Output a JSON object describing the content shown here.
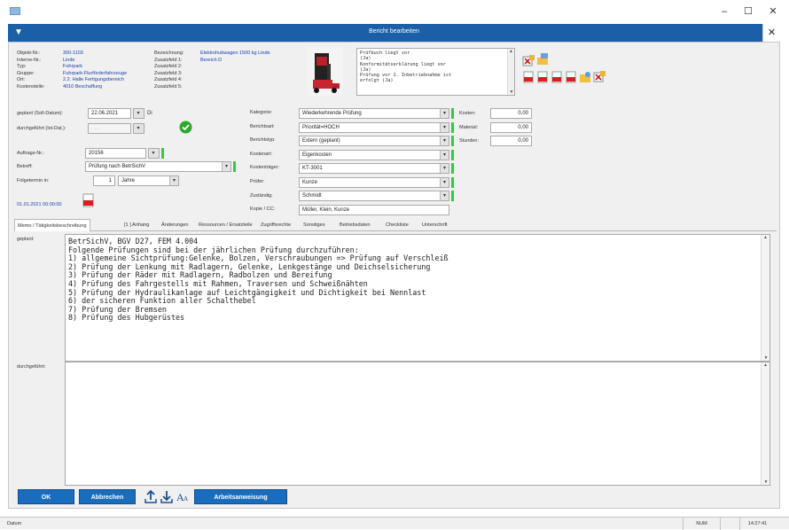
{
  "window": {
    "minimize": "–",
    "maximize": "☐",
    "close": "✕"
  },
  "dialog": {
    "title": "Bericht bearbeiten",
    "close": "✕"
  },
  "object_info": {
    "labels": [
      "Objekt-Nr.:",
      "Interne-Nr.:",
      "Typ:",
      "Gruppe:",
      "Ort:",
      "Kostenstelle:"
    ],
    "values": [
      "300-1103",
      "Linde",
      "Fuhrpark",
      "Fuhrpark-Flurförderfahrzeuge",
      "2.2. Halle Fertigungsbereich",
      "4010 Beschaffung"
    ],
    "labels2": [
      "Bezeichnung:",
      "Zusatzfeld 1:",
      "Zusatzfeld 2:",
      "Zusatzfeld 3:",
      "Zusatzfeld 4:",
      "Zusatzfeld 5:"
    ],
    "values2": [
      "Elektrohubwagen 1500 kg Linde",
      "Bereich D",
      "",
      "",
      "",
      ""
    ]
  },
  "notes_memo": "Prüfbuch liegt vor\n(Ja)\nKonformitätserklärung liegt vor\n(Ja)\nPrüfung vor 1. Inbetriebnahme ist\nerfolgt (Ja)",
  "dates": {
    "planned_label": "geplant (Soll-Datum):",
    "planned_value": "22.06.2021",
    "planned_day": "Di",
    "done_label": "durchgeführt (Ist-Dat.):",
    "done_value": ". . ."
  },
  "order": {
    "auftrag_label": "Auftrags-Nr.:",
    "auftrag_value": "20156",
    "betreff_label": "Betreff:",
    "betreff_value": "Prüfung nach BetrSichV",
    "folgetermin_label": "Folgetermin in:",
    "folgetermin_value": "1",
    "folgetermin_unit": "Jahre",
    "next_date_link": "01.01.2021 00:00:00"
  },
  "classification": {
    "labels": [
      "Kategorie:",
      "Berichtsart:",
      "Berichtstyp:",
      "Kostenart:",
      "Kostenträger:",
      "Prüfer:",
      "Zuständig:",
      "Kopie / CC:"
    ],
    "values": [
      "Wiederkehrende Prüfung",
      "Priorität=HOCH",
      "Extern (geplant)",
      "Eigenkosten",
      "KT-3001",
      "Kunze",
      "Schmidt",
      "Müller, Klein, Kunze"
    ]
  },
  "costs": {
    "labels": [
      "Kosten:",
      "Material:",
      "Stunden:"
    ],
    "values": [
      "0,00",
      "0,00",
      "0,00"
    ]
  },
  "tabs": [
    "Memo / Tätigkeitsbeschreibung",
    "[1 ] Anhang",
    "Änderungen",
    "Ressourcen / Ersatzteile",
    "Zugriffsrechte",
    "Sonstiges",
    "Betriebsdaten",
    "Checkliste",
    "Unterschrift"
  ],
  "memo": {
    "planned_label": "geplant:",
    "planned_text": "BetrSichV, BGV D27, FEM 4.004\nFolgende Prüfungen sind bei der jährlichen Prüfung durchzuführen:\n1) allgemeine Sichtprüfung:Gelenke, Bolzen, Verschraubungen => Prüfung auf Verschleiß\n2) Prüfung der Lenkung mit Radlagern, Gelenke, Lenkgestänge und Deichselsicherung\n3) Prüfung der Räder mit Radlagern, Radbolzen und Bereifung\n4) Prüfung des Fahrgestells mit Rahmen, Traversen und Schweißnähten\n5) Prüfung der Hydraulikanlage auf Leichtgängigkeit und Dichtigkeit bei Nennlast\n6) der sicheren Funktion aller Schalthebel\n7) Prüfung der Bremsen\n8) Prüfung des Hubgerüstes",
    "done_label": "durchgeführt:",
    "done_text": ""
  },
  "buttons": {
    "ok": "OK",
    "cancel": "Abbrechen",
    "work_instruction": "Arbeitsanweisung"
  },
  "statusbar": {
    "left": "Datum",
    "num": "NUM",
    "time": "14:27:41"
  }
}
